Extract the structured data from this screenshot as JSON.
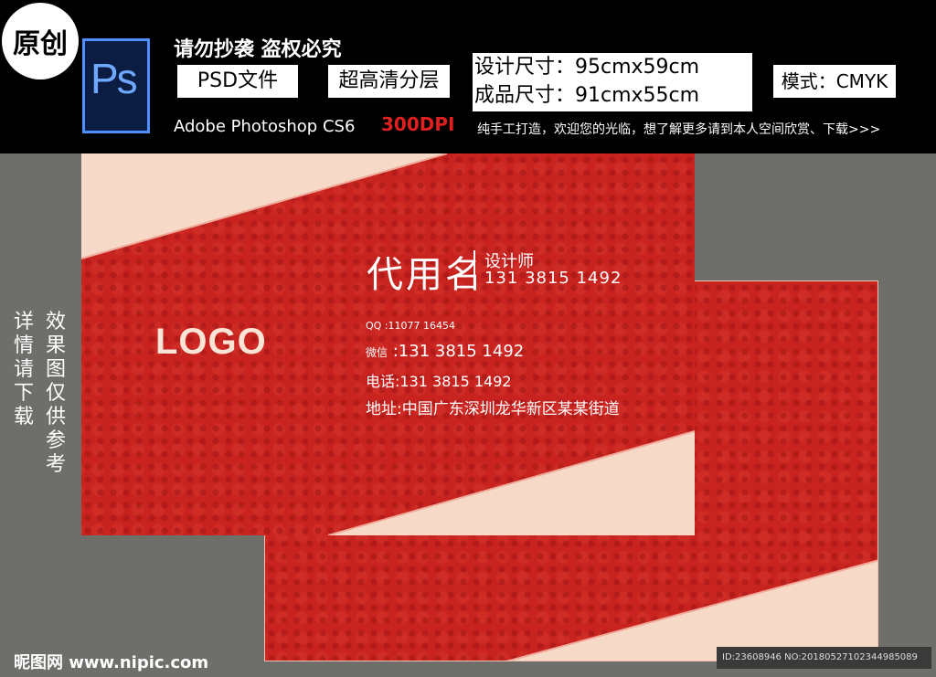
{
  "header": {
    "badge": "原创",
    "ps_logo": "Ps",
    "warning": "请勿抄袭 盗权必究",
    "file_type": "PSD文件",
    "layering": "超高清分层",
    "design_size": "设计尺寸：95cmx59cm",
    "final_size": "成品尺寸：91cmx55cm",
    "mode": "模式：CMYK",
    "software": "Adobe Photoshop CS6",
    "dpi": "300DPI",
    "handmade": "纯手工打造，欢迎您的光临，想了解更多请到本人空间欣赏、下载>>>"
  },
  "side": {
    "detail": "详情请下载",
    "effect": "效果图仅供参考"
  },
  "card": {
    "logo": "LOGO",
    "name": "代用名",
    "title": "设计师",
    "phone_top": "131  3815  1492",
    "qq_label": "QQ",
    "qq_value": "  :11077 16454",
    "wx_label": "微信",
    "wx_value": " :131  3815  1492",
    "tel_label": "电话",
    "tel_value": ":131  3815  1492",
    "addr_label": "地址",
    "addr_value": ":中国广东深圳龙华新区某某街道"
  },
  "footer": {
    "site": "昵图网 www.nipic.com",
    "id_text": "ID:23608946 NO:20180527102344985089"
  },
  "colors": {
    "card_red": "#c8231f",
    "stripe_cream": "#f7d9c8",
    "dpi_red": "#e02020",
    "ps_blue": "#4f8fff"
  }
}
